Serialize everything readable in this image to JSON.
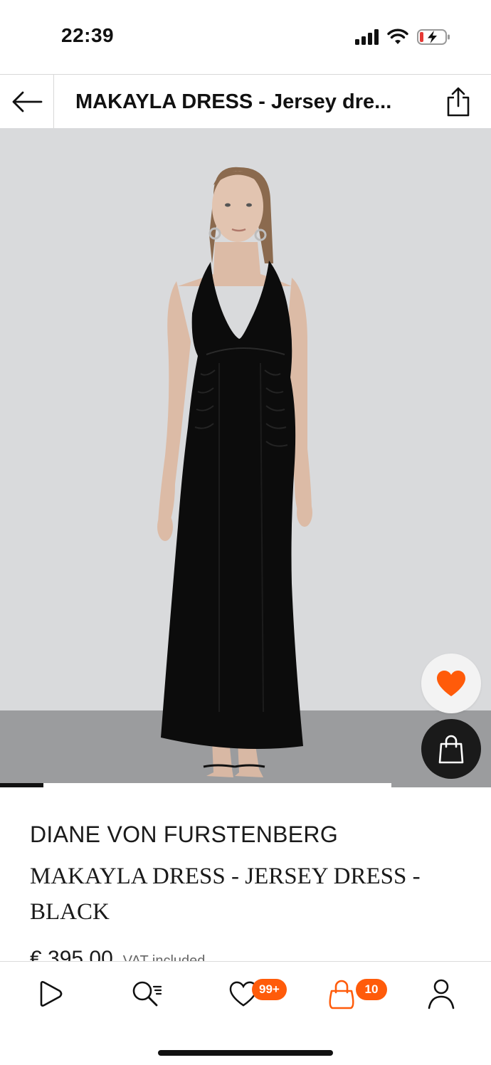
{
  "status_bar": {
    "time": "22:39",
    "icons": [
      "cellular-signal-icon",
      "wifi-icon",
      "battery-charging-icon"
    ]
  },
  "header": {
    "title": "MAKAYLA DRESS - Jersey dre...",
    "back_icon": "arrow-left-icon",
    "share_icon": "share-icon"
  },
  "gallery": {
    "progress": 0.11,
    "image_subject": "black halter jersey maxi dress"
  },
  "actions": {
    "wishlist_icon": "heart-filled-icon",
    "add_to_bag_icon": "shopping-bag-icon"
  },
  "product": {
    "brand": "DIANE VON FURSTENBERG",
    "name": "MAKAYLA DRESS - JERSEY DRESS - BLACK",
    "price": "€ 395.00",
    "vat_note": "VAT included"
  },
  "bottom_nav": {
    "items": [
      {
        "icon": "play-icon",
        "badge": ""
      },
      {
        "icon": "search-icon",
        "badge": ""
      },
      {
        "icon": "heart-icon",
        "badge": "99+"
      },
      {
        "icon": "bag-icon",
        "badge": "10"
      },
      {
        "icon": "profile-icon",
        "badge": ""
      }
    ]
  },
  "colors": {
    "accent": "#ff5b0a",
    "text": "#1a1a1a",
    "image_background": "#d9dadc"
  }
}
